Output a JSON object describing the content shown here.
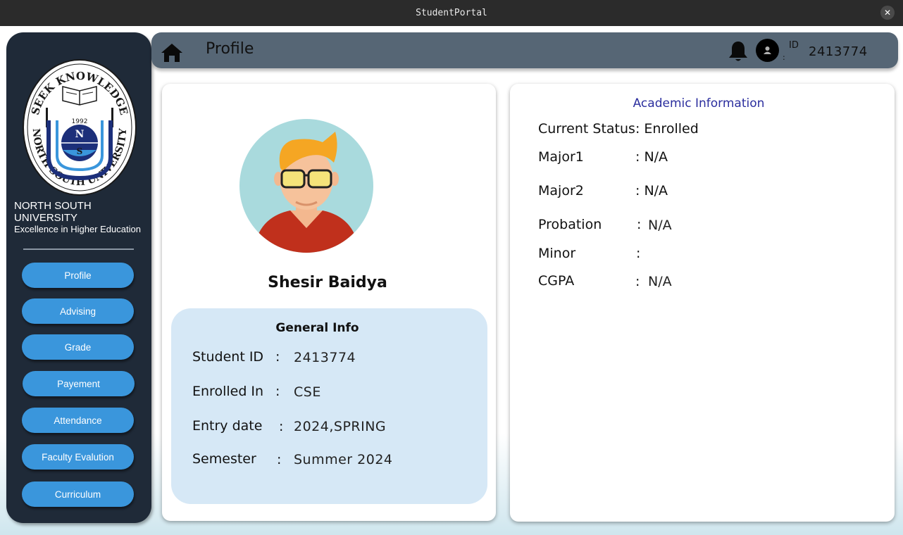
{
  "window": {
    "title": "StudentPortal",
    "close_symbol": "✕"
  },
  "sidebar": {
    "university_name": "NORTH SOUTH UNIVERSITY",
    "motto": "Excellence in Higher Education",
    "logo": {
      "top_text": "SEEK KNOWLEDGE",
      "bottom_text": "NORTH SOUTH UNIVERSITY",
      "year": "1992",
      "letters": [
        "N",
        "S"
      ]
    },
    "nav": [
      "Profile",
      "Advising",
      "Grade",
      "Payement",
      "Attendance",
      "Faculty Evalution",
      "Curriculum"
    ]
  },
  "header": {
    "title": "Profile",
    "id_label": "ID",
    "id_colon": ":",
    "id_value": "2413774",
    "icons": [
      "home-icon",
      "bell-icon",
      "user-avatar-icon"
    ]
  },
  "profile": {
    "name": "Shesir Baidya",
    "general_info": {
      "title": "General Info",
      "rows": [
        {
          "label": "Student ID",
          "value": "2413774"
        },
        {
          "label": "Enrolled In",
          "value": "CSE"
        },
        {
          "label": "Entry date",
          "value": "2024,SPRING"
        },
        {
          "label": "Semester",
          "value": "Summer 2024"
        }
      ]
    }
  },
  "academic": {
    "title": "Academic Information",
    "current_status": "Current Status: Enrolled",
    "rows": [
      {
        "label": "Major1",
        "value": ": N/A"
      },
      {
        "label": "Major2",
        "value": ": N/A"
      },
      {
        "label": "Probation",
        "value": "N/A"
      },
      {
        "label": "Minor",
        "value": ""
      },
      {
        "label": "CGPA",
        "value": "N/A"
      }
    ]
  },
  "colors": {
    "sidebar_bg": "#1f2a38",
    "nav_button": "#3a96dc",
    "header_bg": "#566675",
    "general_box_bg": "#d6e8f6",
    "academic_title": "#2b2e9e"
  }
}
